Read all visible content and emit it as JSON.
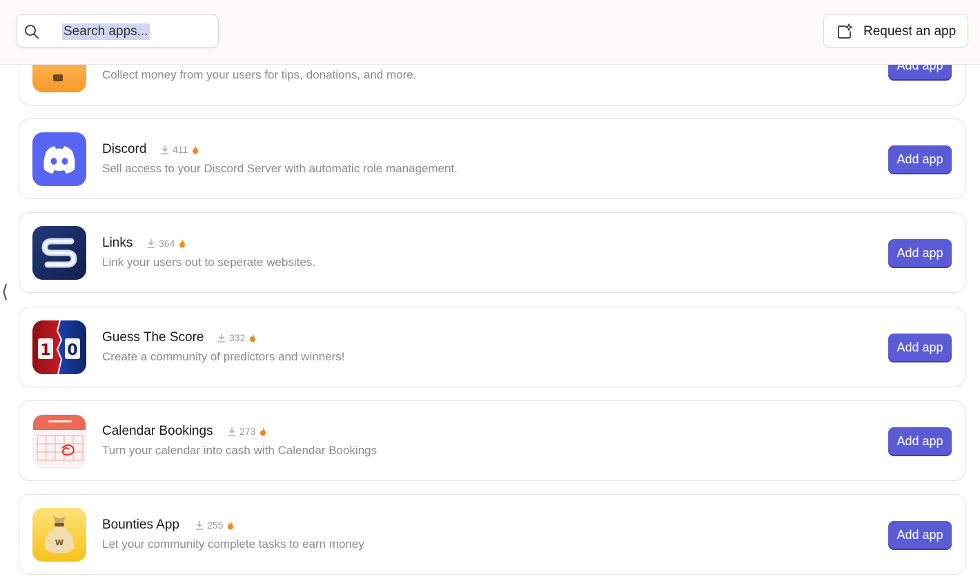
{
  "search": {
    "placeholder": "Search apps..."
  },
  "header": {
    "request_label": "Request an app"
  },
  "apps": [
    {
      "name": "",
      "downloads": "",
      "description": "Collect money from your users for tips, donations, and more.",
      "button": "Add app",
      "icon": "tip-jar-icon"
    },
    {
      "name": "Discord",
      "downloads": "411",
      "description": "Sell access to your Discord Server with automatic role management.",
      "button": "Add app",
      "icon": "discord-icon"
    },
    {
      "name": "Links",
      "downloads": "364",
      "description": "Link your users out to seperate websites.",
      "button": "Add app",
      "icon": "links-icon"
    },
    {
      "name": "Guess The Score",
      "downloads": "332",
      "description": "Create a community of predictors and winners!",
      "button": "Add app",
      "icon": "scoreboard-icon"
    },
    {
      "name": "Calendar Bookings",
      "downloads": "273",
      "description": "Turn your calendar into cash with Calendar Bookings",
      "button": "Add app",
      "icon": "calendar-icon"
    },
    {
      "name": "Bounties App",
      "downloads": "255",
      "description": "Let your community complete tasks to earn money",
      "button": "Add app",
      "icon": "money-bag-icon"
    }
  ],
  "colors": {
    "accent": "#5b5bd6",
    "fire": "#f08a1c"
  }
}
